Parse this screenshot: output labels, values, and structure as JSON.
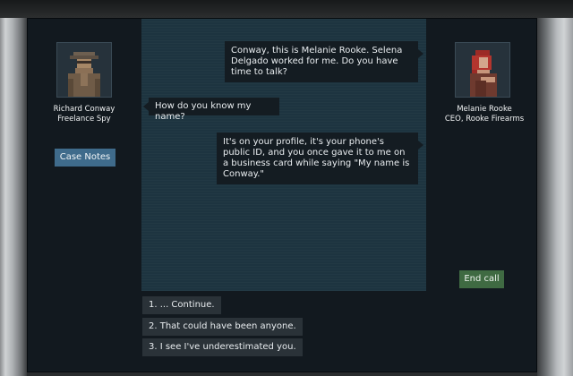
{
  "caller": {
    "name": "Richard Conway",
    "title": "Freelance Spy",
    "portrait_icon": "detective-portrait-icon"
  },
  "contact": {
    "name": "Melanie Rooke",
    "title": "CEO, Rooke Firearms",
    "portrait_icon": "red-haired-woman-portrait-icon"
  },
  "buttons": {
    "case_notes": "Case Notes",
    "end_call": "End call"
  },
  "messages": [
    {
      "speaker": "contact",
      "text": "Conway, this is Melanie Rooke. Selena Delgado worked for me. Do you have time to talk?"
    },
    {
      "speaker": "caller",
      "text": "How do you know my name?"
    },
    {
      "speaker": "contact",
      "text": "It's on your profile, it's your phone's public ID, and you once gave it to me on a business card while saying \"My name is Conway.\""
    }
  ],
  "choices": [
    {
      "label": "1. ... Continue."
    },
    {
      "label": "2. That could have been anyone."
    },
    {
      "label": "3. I see I've underestimated you."
    }
  ],
  "colors": {
    "panel": "#1d3440",
    "frame": "#12191f",
    "case_notes_button": "#3f6b8b",
    "end_call_button": "#3f6a42"
  }
}
